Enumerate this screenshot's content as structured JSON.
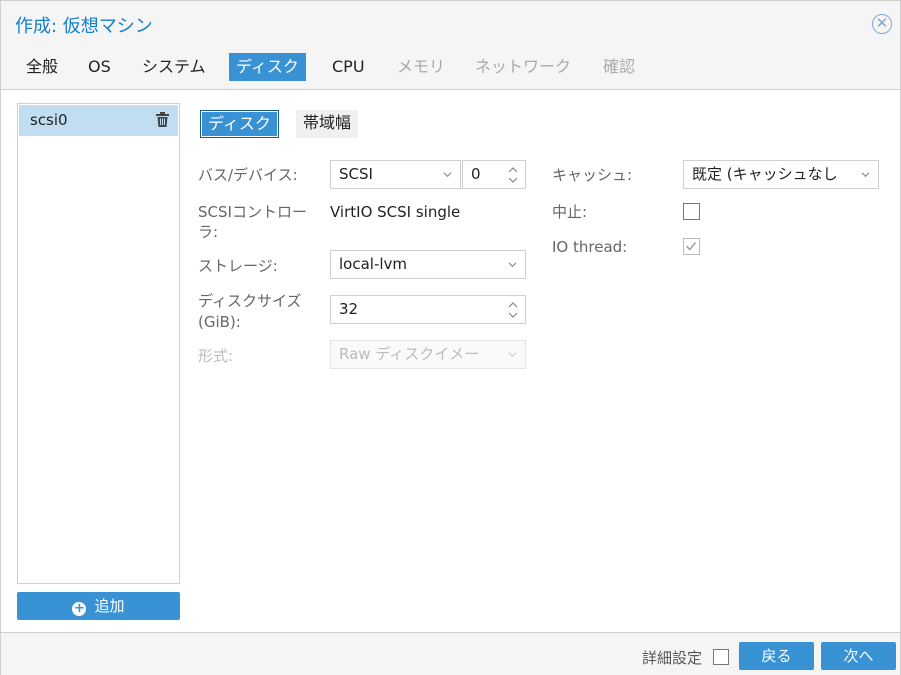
{
  "window": {
    "title": "作成: 仮想マシン"
  },
  "tabs": [
    {
      "label": "全般",
      "state": "normal"
    },
    {
      "label": "OS",
      "state": "normal"
    },
    {
      "label": "システム",
      "state": "normal"
    },
    {
      "label": "ディスク",
      "state": "active"
    },
    {
      "label": "CPU",
      "state": "normal"
    },
    {
      "label": "メモリ",
      "state": "disabled"
    },
    {
      "label": "ネットワーク",
      "state": "disabled"
    },
    {
      "label": "確認",
      "state": "disabled"
    }
  ],
  "disk_list": {
    "items": [
      "scsi0"
    ],
    "add_label": "追加"
  },
  "subtabs": [
    {
      "label": "ディスク",
      "active": true
    },
    {
      "label": "帯域幅",
      "active": false
    }
  ],
  "form": {
    "bus_label": "バス/デバイス:",
    "bus_value": "SCSI",
    "device_value": "0",
    "controller_label_1": "SCSIコントロー",
    "controller_label_2": "ラ:",
    "controller_value": "VirtIO SCSI single",
    "storage_label": "ストレージ:",
    "storage_value": "local-lvm",
    "size_label_1": "ディスクサイズ",
    "size_label_2": "(GiB):",
    "size_value": "32",
    "format_label": "形式:",
    "format_value": "Raw ディスクイメー",
    "cache_label": "キャッシュ:",
    "cache_value": "既定 (キャッシュなし",
    "discard_label": "中止:",
    "discard_checked": false,
    "iothread_label": "IO thread:",
    "iothread_checked": true
  },
  "footer": {
    "advanced_label": "詳細設定",
    "advanced_checked": false,
    "back_label": "戻る",
    "next_label": "次へ"
  },
  "colors": {
    "accent": "#3892d4",
    "title": "#157fcc",
    "selected_row": "#c1ddf1"
  }
}
